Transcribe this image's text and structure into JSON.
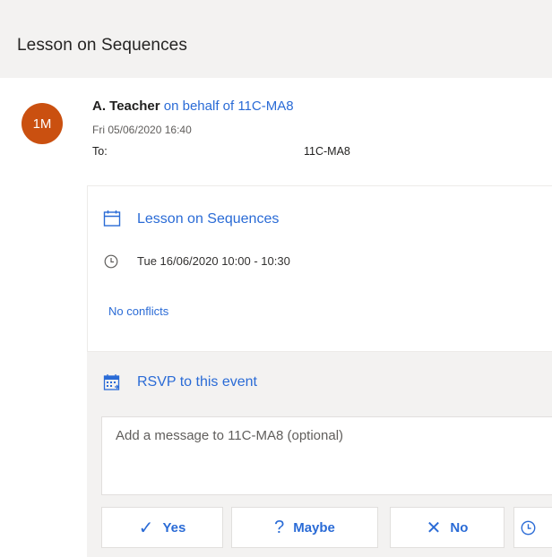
{
  "header": {
    "subject": "Lesson on Sequences"
  },
  "message": {
    "avatar_initials": "1M",
    "avatar_color": "#ca5010",
    "sender_name": "A. Teacher",
    "on_behalf": "on behalf of 11C-MA8",
    "sent": "Fri 05/06/2020 16:40",
    "to_label": "To:",
    "to_value": "11C-MA8"
  },
  "event": {
    "title": "Lesson on Sequences",
    "time": "Tue 16/06/2020 10:00 - 10:30",
    "conflicts": "No conflicts",
    "calendar_icon": "calendar-icon",
    "clock_icon": "clock-icon"
  },
  "rsvp": {
    "title": "RSVP to this event",
    "icon": "calendar-reply-icon",
    "message_placeholder": "Add a message to 11C-MA8 (optional)",
    "buttons": {
      "yes": {
        "icon": "✓",
        "label": "Yes"
      },
      "maybe": {
        "icon": "?",
        "label": "Maybe"
      },
      "no": {
        "icon": "✕",
        "label": "No"
      }
    }
  },
  "colors": {
    "link": "#2a6bd6",
    "header_bg": "#f3f2f1",
    "panel_bg": "#f3f2f1"
  }
}
